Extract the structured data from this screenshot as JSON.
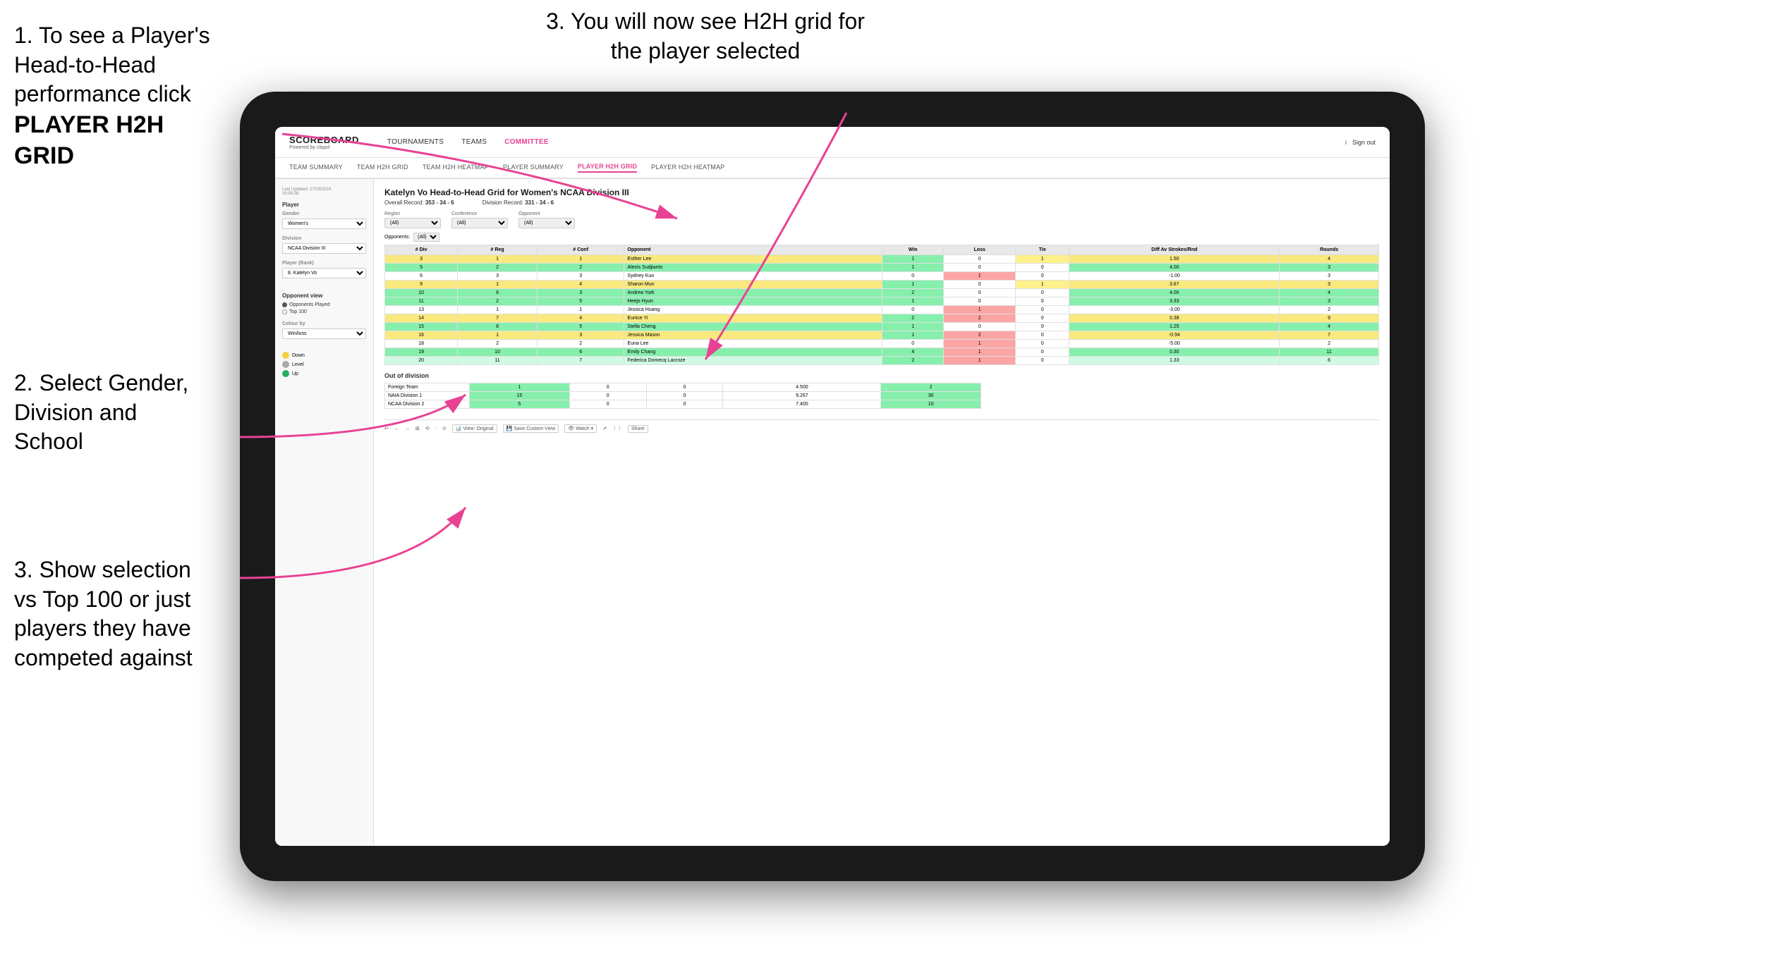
{
  "instructions": {
    "step1_prefix": "1. To see a Player's Head-to-Head performance click",
    "step1_bold": "PLAYER H2H GRID",
    "step2": "2. Select Gender, Division and School",
    "step3_left": "3. Show selection vs Top 100 or just players they have competed against",
    "step3_right": "3. You will now see H2H grid for the player selected"
  },
  "header": {
    "logo": "SCOREBOARD",
    "logo_sub": "Powered by clippd",
    "nav_items": [
      "TOURNAMENTS",
      "TEAMS",
      "COMMITTEE"
    ],
    "sign_out": "Sign out"
  },
  "sub_nav": {
    "items": [
      "TEAM SUMMARY",
      "TEAM H2H GRID",
      "TEAM H2H HEATMAP",
      "PLAYER SUMMARY",
      "PLAYER H2H GRID",
      "PLAYER H2H HEATMAP"
    ]
  },
  "sidebar": {
    "last_updated_label": "Last Updated: 27/03/2024",
    "last_updated_time": "16:55:38",
    "player_label": "Player",
    "gender_label": "Gender",
    "gender_value": "Women's",
    "division_label": "Division",
    "division_value": "NCAA Division III",
    "player_rank_label": "Player (Rank)",
    "player_rank_value": "8. Katelyn Vo",
    "opponent_view_label": "Opponent view",
    "radio1": "Opponents Played",
    "radio2": "Top 100",
    "colour_by_label": "Colour by",
    "colour_by_value": "Win/loss",
    "legend_down": "Down",
    "legend_level": "Level",
    "legend_up": "Up"
  },
  "grid": {
    "title": "Katelyn Vo Head-to-Head Grid for Women's NCAA Division III",
    "overall_record_label": "Overall Record:",
    "overall_record_value": "353 - 34 - 6",
    "division_record_label": "Division Record:",
    "division_record_value": "331 - 34 - 6",
    "region_label": "Region",
    "conference_label": "Conference",
    "opponent_label": "Opponent",
    "opponents_label": "Opponents:",
    "all_option": "(All)",
    "columns": [
      "# Div",
      "# Reg",
      "# Conf",
      "Opponent",
      "Win",
      "Loss",
      "Tie",
      "Diff Av Strokes/Rnd",
      "Rounds"
    ],
    "rows": [
      {
        "div": "3",
        "reg": "1",
        "conf": "1",
        "opponent": "Esther Lee",
        "win": 1,
        "loss": 0,
        "tie": 1,
        "diff": "1.50",
        "rounds": 4,
        "color": "yellow"
      },
      {
        "div": "5",
        "reg": "2",
        "conf": "2",
        "opponent": "Alexis Sudjianto",
        "win": 1,
        "loss": 0,
        "tie": 0,
        "diff": "4.00",
        "rounds": 3,
        "color": "green"
      },
      {
        "div": "6",
        "reg": "3",
        "conf": "3",
        "opponent": "Sydney Kuo",
        "win": 0,
        "loss": 1,
        "tie": 0,
        "diff": "-1.00",
        "rounds": 3,
        "color": "white"
      },
      {
        "div": "9",
        "reg": "1",
        "conf": "4",
        "opponent": "Sharon Mun",
        "win": 1,
        "loss": 0,
        "tie": 1,
        "diff": "3.67",
        "rounds": 3,
        "color": "yellow"
      },
      {
        "div": "10",
        "reg": "6",
        "conf": "3",
        "opponent": "Andrea York",
        "win": 2,
        "loss": 0,
        "tie": 0,
        "diff": "4.00",
        "rounds": 4,
        "color": "green"
      },
      {
        "div": "11",
        "reg": "2",
        "conf": "5",
        "opponent": "Heejo Hyun",
        "win": 1,
        "loss": 0,
        "tie": 0,
        "diff": "3.33",
        "rounds": 3,
        "color": "green"
      },
      {
        "div": "13",
        "reg": "1",
        "conf": "1",
        "opponent": "Jessica Huang",
        "win": 0,
        "loss": 1,
        "tie": 0,
        "diff": "-3.00",
        "rounds": 2,
        "color": "white"
      },
      {
        "div": "14",
        "reg": "7",
        "conf": "4",
        "opponent": "Eunice Yi",
        "win": 2,
        "loss": 2,
        "tie": 0,
        "diff": "0.38",
        "rounds": 9,
        "color": "yellow"
      },
      {
        "div": "15",
        "reg": "8",
        "conf": "5",
        "opponent": "Stella Cheng",
        "win": 1,
        "loss": 0,
        "tie": 0,
        "diff": "1.25",
        "rounds": 4,
        "color": "green"
      },
      {
        "div": "16",
        "reg": "1",
        "conf": "3",
        "opponent": "Jessica Mason",
        "win": 1,
        "loss": 2,
        "tie": 0,
        "diff": "-0.94",
        "rounds": 7,
        "color": "yellow"
      },
      {
        "div": "18",
        "reg": "2",
        "conf": "2",
        "opponent": "Euna Lee",
        "win": 0,
        "loss": 1,
        "tie": 0,
        "diff": "-5.00",
        "rounds": 2,
        "color": "white"
      },
      {
        "div": "19",
        "reg": "10",
        "conf": "6",
        "opponent": "Emily Chang",
        "win": 4,
        "loss": 1,
        "tie": 0,
        "diff": "0.30",
        "rounds": 11,
        "color": "green"
      },
      {
        "div": "20",
        "reg": "11",
        "conf": "7",
        "opponent": "Federica Domecq Lacroze",
        "win": 2,
        "loss": 1,
        "tie": 0,
        "diff": "1.33",
        "rounds": 6,
        "color": "light-green"
      }
    ],
    "out_of_division_label": "Out of division",
    "out_of_division_rows": [
      {
        "label": "Foreign Team",
        "win": 1,
        "loss": 0,
        "tie": 0,
        "diff": "4.500",
        "rounds": 2
      },
      {
        "label": "NAIA Division 1",
        "win": 15,
        "loss": 0,
        "tie": 0,
        "diff": "9.267",
        "rounds": 30
      },
      {
        "label": "NCAA Division 2",
        "win": 5,
        "loss": 0,
        "tie": 0,
        "diff": "7.400",
        "rounds": 10
      }
    ]
  },
  "toolbar": {
    "buttons": [
      "↩",
      "←",
      "→",
      "⊞",
      "⟲",
      "·",
      "⊙",
      "View: Original",
      "Save Custom View",
      "Watch ▾",
      "↗",
      "⋮⋮",
      "Share"
    ]
  }
}
